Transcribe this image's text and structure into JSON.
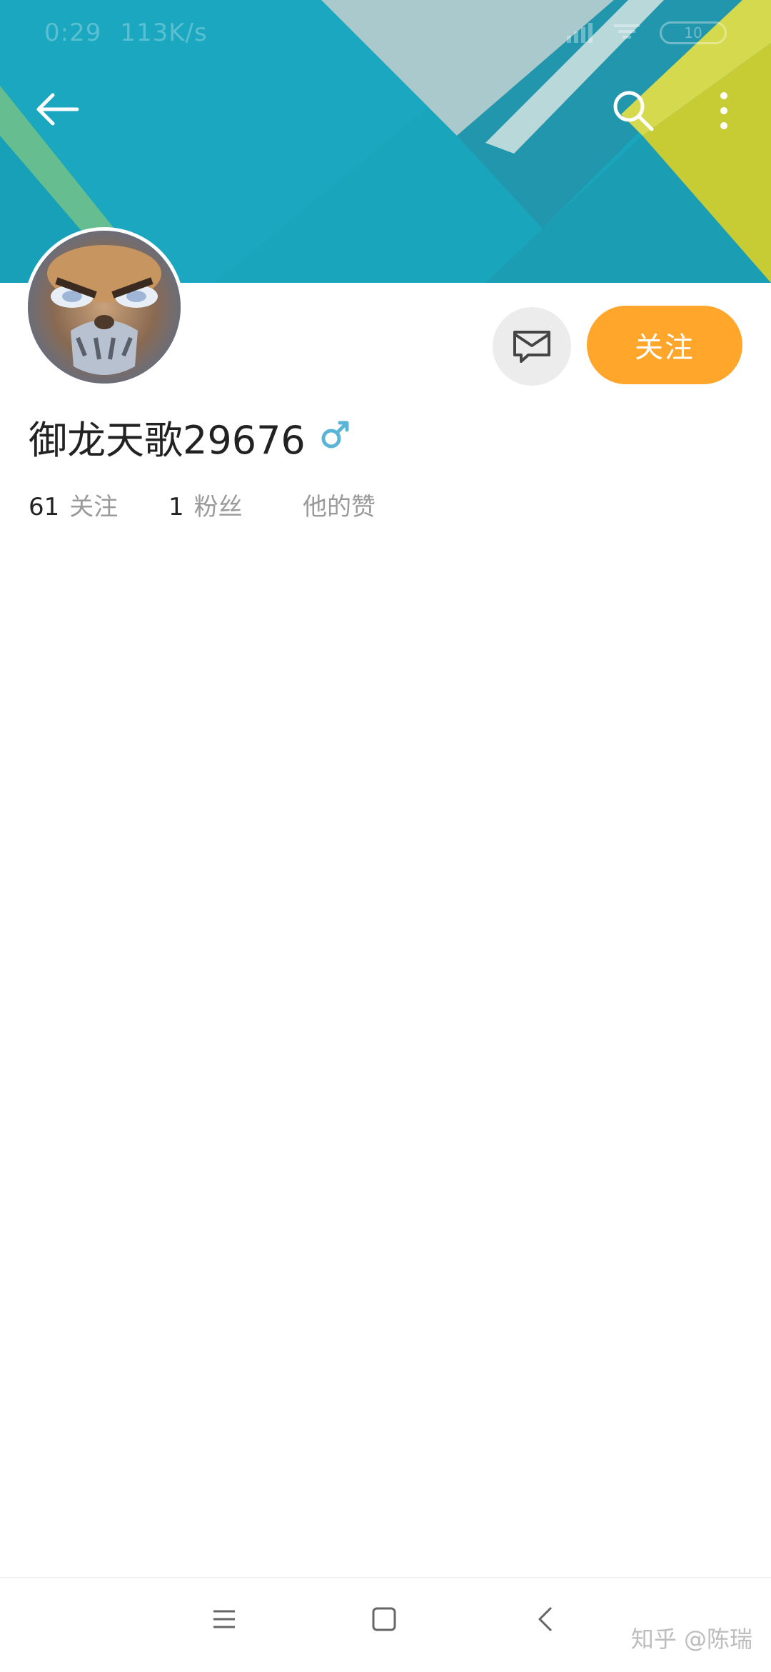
{
  "status_bar": {
    "time": "0:29",
    "speed": "113K/s",
    "battery": "10"
  },
  "header": {
    "back_icon": "arrow-left-icon",
    "search_icon": "search-icon",
    "more_icon": "more-vertical-icon"
  },
  "profile": {
    "username": "御龙天歌29676",
    "gender_icon": "male-icon",
    "message_icon": "message-icon",
    "follow_label": "关注",
    "stats": [
      {
        "count": "61",
        "label": "关注"
      },
      {
        "count": "1",
        "label": "粉丝"
      },
      {
        "count": "",
        "label": "他的赞"
      }
    ]
  },
  "nav_bar": {
    "menu_icon": "menu-icon",
    "home_icon": "home-square-icon",
    "back_icon": "chevron-left-icon"
  },
  "watermark": "知乎 @陈瑞",
  "colors": {
    "accent": "#ffa62b",
    "banner_teal": "#18a9bf",
    "banner_yellow": "#c9cf3a",
    "gender_blue": "#5ab4d8"
  }
}
